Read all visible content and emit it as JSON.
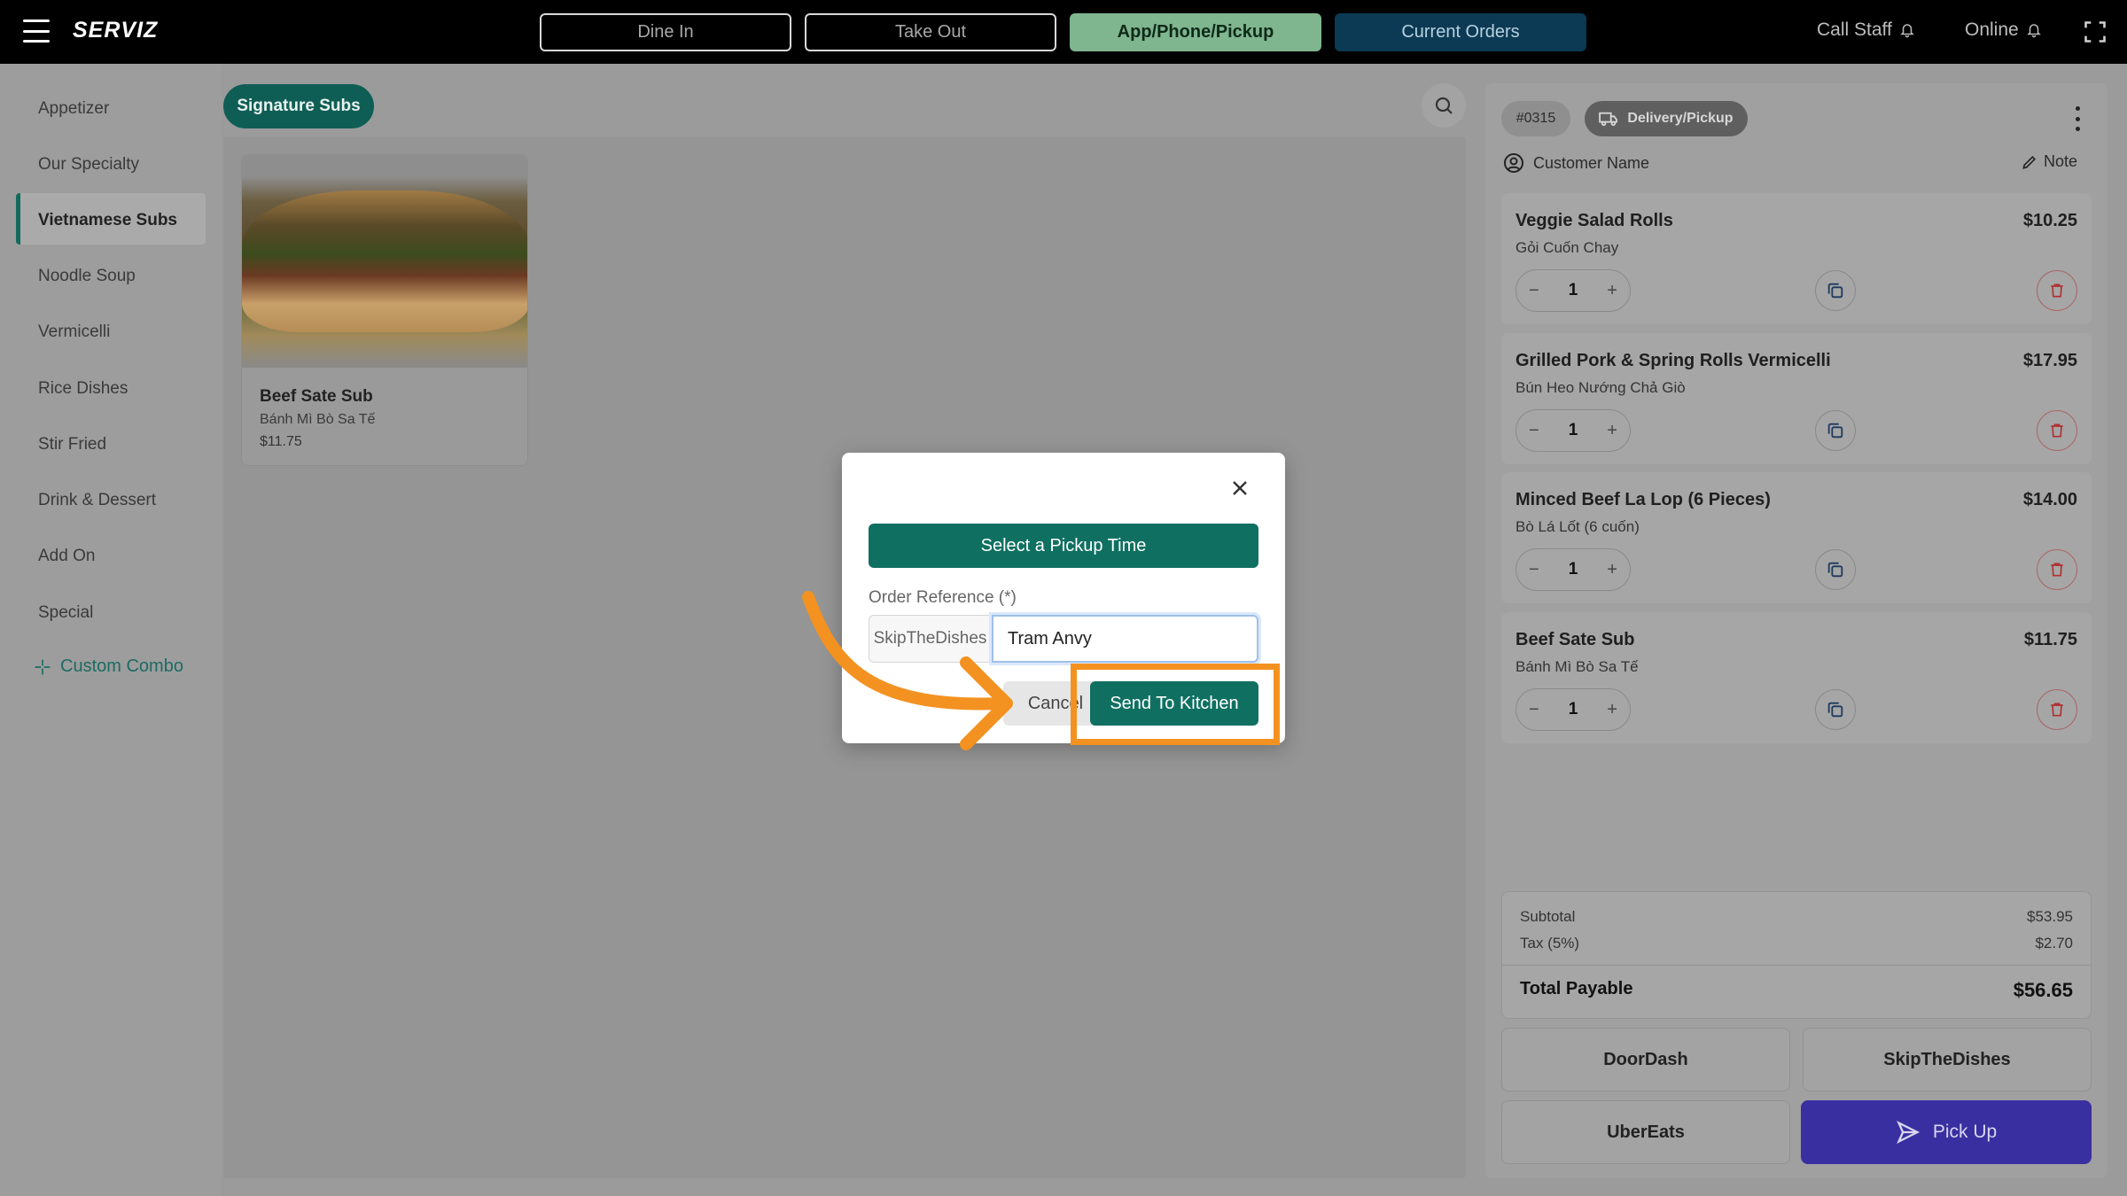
{
  "header": {
    "brand": "SERVIZ",
    "modes": [
      {
        "label": "Dine In",
        "state": "inactive"
      },
      {
        "label": "Take Out",
        "state": "inactive"
      },
      {
        "label": "App/Phone/Pickup",
        "state": "active"
      },
      {
        "label": "Current Orders",
        "state": "orders"
      }
    ],
    "call_staff": "Call Staff",
    "online": "Online"
  },
  "sidebar": {
    "categories": [
      "Appetizer",
      "Our Specialty",
      "Vietnamese Subs",
      "Noodle Soup",
      "Vermicelli",
      "Rice Dishes",
      "Stir Fried",
      "Drink & Dessert",
      "Add On",
      "Special"
    ],
    "active": "Vietnamese Subs",
    "custom_combo": "Custom Combo"
  },
  "menu": {
    "subcategory": "Signature Subs",
    "items": [
      {
        "name": "Beef Sate Sub",
        "subtitle": "Bánh Mì Bò Sa Tế",
        "price": "$11.75"
      }
    ]
  },
  "order": {
    "number": "#0315",
    "type": "Delivery/Pickup",
    "customer_label": "Customer Name",
    "note_label": "Note",
    "items": [
      {
        "name": "Veggie Salad Rolls",
        "subtitle": "Gỏi Cuốn Chay",
        "price": "$10.25",
        "qty": "1"
      },
      {
        "name": "Grilled Pork & Spring Rolls Vermicelli",
        "subtitle": "Bún Heo Nướng Chả Giò",
        "price": "$17.95",
        "qty": "1"
      },
      {
        "name": "Minced Beef La Lop (6 Pieces)",
        "subtitle": "Bò Lá Lốt (6 cuốn)",
        "price": "$14.00",
        "qty": "1"
      },
      {
        "name": "Beef Sate Sub",
        "subtitle": "Bánh Mì Bò Sa Tế",
        "price": "$11.75",
        "qty": "1"
      }
    ],
    "subtotal_label": "Subtotal",
    "subtotal": "$53.95",
    "tax_label": "Tax (5%)",
    "tax": "$2.70",
    "total_label": "Total Payable",
    "total": "$56.65",
    "channels": [
      "DoorDash",
      "SkipTheDishes",
      "UberEats"
    ],
    "pickup_label": "Pick Up"
  },
  "modal": {
    "pickup_time_label": "Select a Pickup Time",
    "ref_label": "Order Reference (*)",
    "ref_prefix": "SkipTheDishes",
    "ref_value": "Tram Anvy",
    "cancel_label": "Cancel",
    "send_label": "Send To Kitchen"
  },
  "colors": {
    "accent": "#0f7061",
    "annotation": "#f39221",
    "pickup": "#3a2fa0"
  }
}
